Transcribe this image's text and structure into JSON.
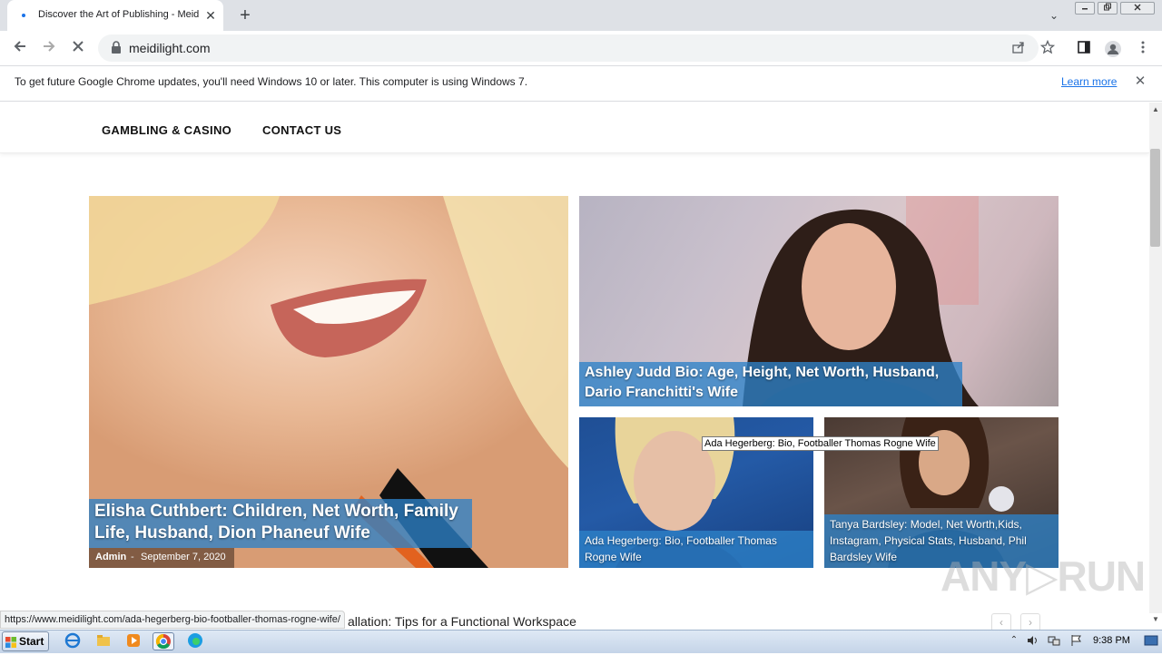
{
  "browser": {
    "tab_title": "Discover the Art of Publishing - Meid",
    "tab_close": "✕",
    "new_tab": "+",
    "tab_list": "⌄",
    "url": "meidilight.com",
    "infobar_text": "To get future Google Chrome updates, you'll need Windows 10 or later. This computer is using Windows 7.",
    "learn_more": "Learn more",
    "infobar_close": "✕",
    "status_url": "https://www.meidilight.com/ada-hegerberg-bio-footballer-thomas-rogne-wife/",
    "icons": {
      "back": "back-arrow-icon",
      "forward": "forward-arrow-icon",
      "stop": "stop-loading-icon",
      "lock": "lock-icon",
      "share": "share-icon",
      "bookmark": "star-icon",
      "sidepanel": "side-panel-icon",
      "profile": "profile-icon",
      "menu": "kebab-menu-icon"
    }
  },
  "site": {
    "nav": [
      "GAMBLING & CASINO",
      "CONTACT US"
    ],
    "cards": [
      {
        "title": "Elisha Cuthbert: Children, Net Worth, Family Life, Husband, Dion Phaneuf Wife",
        "author": "Admin",
        "separator": "-",
        "date": "September 7, 2020"
      },
      {
        "title": "Ashley Judd Bio: Age, Height, Net Worth, Husband, Dario Franchitti's Wife"
      },
      {
        "title": "Ada Hegerberg: Bio, Footballer Thomas Rogne Wife"
      },
      {
        "title": "Tanya Bardsley: Model, Net Worth,Kids, Instagram, Physical Stats, Husband, Phil Bardsley Wife"
      }
    ],
    "tooltip": "Ada Hegerberg: Bio, Footballer Thomas Rogne Wife",
    "partial_headline": "allation: Tips for a Functional Workspace",
    "carousel_prev": "‹",
    "carousel_next": "›"
  },
  "watermark": "ANY▷RUN",
  "taskbar": {
    "start_label": "Start",
    "clock": "9:38 PM"
  }
}
